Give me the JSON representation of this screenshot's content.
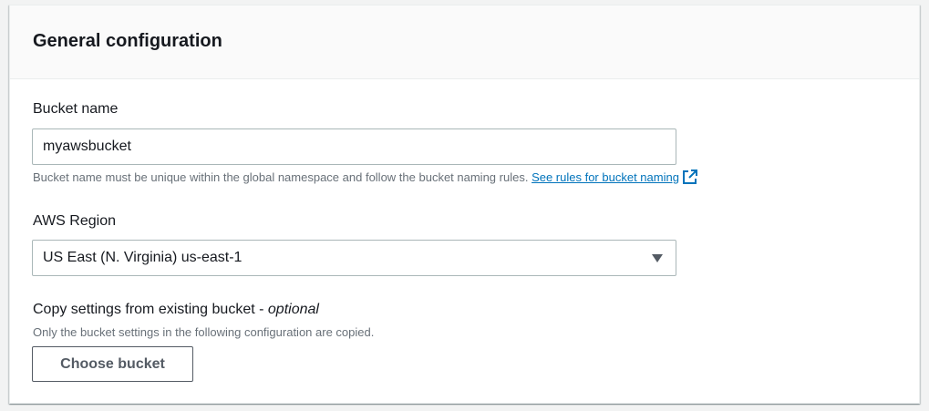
{
  "panel": {
    "title": "General configuration"
  },
  "bucket_name": {
    "label": "Bucket name",
    "value": "myawsbucket",
    "hint": "Bucket name must be unique within the global namespace and follow the bucket naming rules.",
    "link_text": "See rules for bucket naming",
    "link_icon": "external-link-icon"
  },
  "region": {
    "label": "AWS Region",
    "selected": "US East (N. Virginia) us-east-1",
    "icon": "caret-down-icon"
  },
  "copy_settings": {
    "label": "Copy settings from existing bucket - ",
    "label_optional": "optional",
    "hint": "Only the bucket settings in the following configuration are copied.",
    "button_label": "Choose bucket"
  },
  "colors": {
    "link": "#0073bb",
    "text": "#16191f",
    "hint": "#687078",
    "border": "#aab7b8"
  }
}
